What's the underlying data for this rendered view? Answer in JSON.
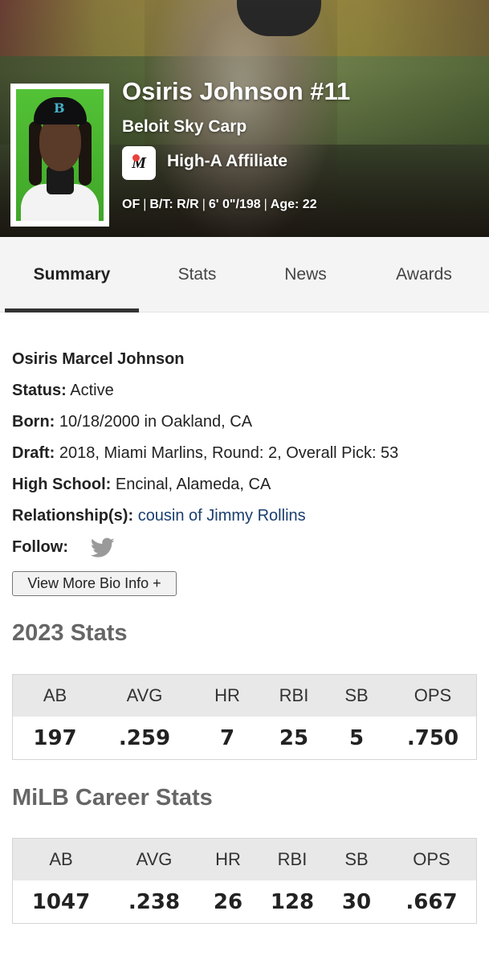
{
  "hero": {
    "name": "Osiris Johnson #11",
    "team": "Beloit Sky Carp",
    "affiliate": "High-A Affiliate",
    "position": "OF",
    "bats_throws": "B/T: R/R",
    "height_weight": "6' 0\"/198",
    "age": "Age: 22"
  },
  "tabs": [
    {
      "label": "Summary",
      "active": true
    },
    {
      "label": "Stats",
      "active": false
    },
    {
      "label": "News",
      "active": false
    },
    {
      "label": "Awards",
      "active": false
    }
  ],
  "bio": {
    "full_name": "Osiris Marcel Johnson",
    "status_label": "Status:",
    "status_value": "Active",
    "born_label": "Born:",
    "born_value": "10/18/2000 in Oakland, CA",
    "draft_label": "Draft:",
    "draft_value": "2018, Miami Marlins, Round: 2, Overall Pick: 53",
    "school_label": "High School:",
    "school_value": "Encinal, Alameda, CA",
    "relationship_label": "Relationship(s):",
    "relationship_value": "cousin of Jimmy Rollins",
    "follow_label": "Follow:",
    "more_button": "View More Bio Info +"
  },
  "stats_2023": {
    "title": "2023 Stats",
    "headers": [
      "AB",
      "AVG",
      "HR",
      "RBI",
      "SB",
      "OPS"
    ],
    "values": [
      "197",
      ".259",
      "7",
      "25",
      "5",
      ".750"
    ]
  },
  "career_stats": {
    "title": "MiLB Career Stats",
    "headers": [
      "AB",
      "AVG",
      "HR",
      "RBI",
      "SB",
      "OPS"
    ],
    "values": [
      "1047",
      ".238",
      "26",
      "128",
      "30",
      ".667"
    ]
  },
  "colors": {
    "accent_tab": "#333333",
    "link": "#1a3e6e",
    "twitter_icon": "#9a9a9a",
    "headshot_bg": "#4cbb30"
  }
}
